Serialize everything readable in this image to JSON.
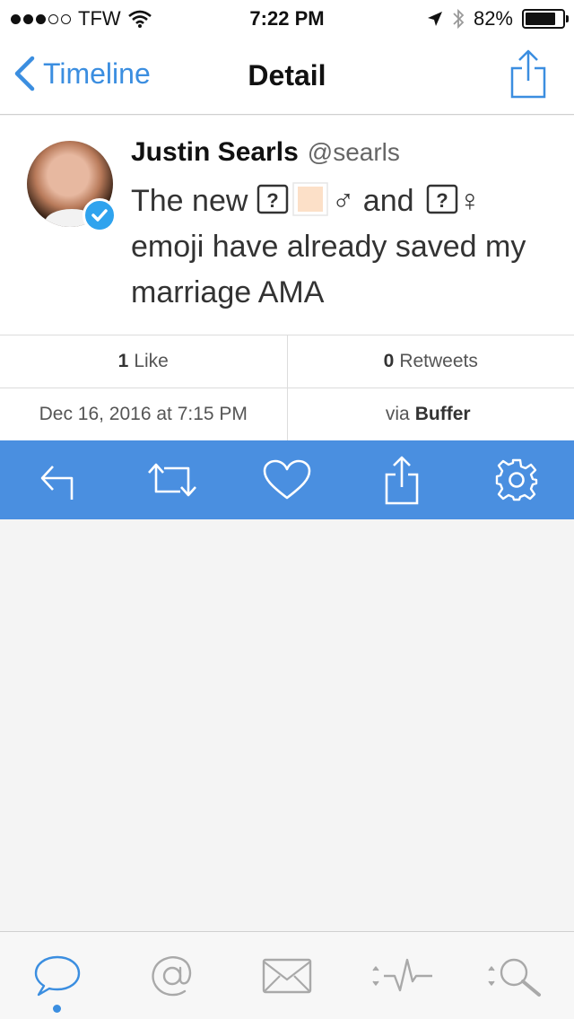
{
  "status_bar": {
    "carrier": "TFW",
    "time": "7:22 PM",
    "battery": "82%",
    "battery_level": 0.82,
    "signal_bars": 3,
    "signal_total": 5
  },
  "nav": {
    "back_label": "Timeline",
    "title": "Detail"
  },
  "tweet": {
    "author_name": "Justin Searls",
    "author_handle": "@searls",
    "text_part1": "The new ",
    "text_part2": " and ",
    "text_part3": " emoji have already saved my marriage AMA",
    "male_sign": "♂",
    "female_sign": "♀",
    "missing_glyph": "?"
  },
  "stats": {
    "likes_count": "1",
    "likes_label": "Like",
    "retweets_count": "0",
    "retweets_label": "Retweets",
    "date": "Dec 16, 2016 at 7:15 PM",
    "via_prefix": "via",
    "via_source": "Buffer"
  },
  "colors": {
    "accent": "#3b8ee0",
    "action_bar": "#4a8fe0",
    "verified": "#2fa3ee"
  },
  "icons": {
    "action_bar": [
      "reply-icon",
      "retweet-icon",
      "heart-icon",
      "share-icon",
      "gear-icon"
    ],
    "tab_bar": [
      "speech-bubble-icon",
      "at-sign-icon",
      "envelope-icon",
      "activity-icon",
      "search-icon"
    ]
  }
}
